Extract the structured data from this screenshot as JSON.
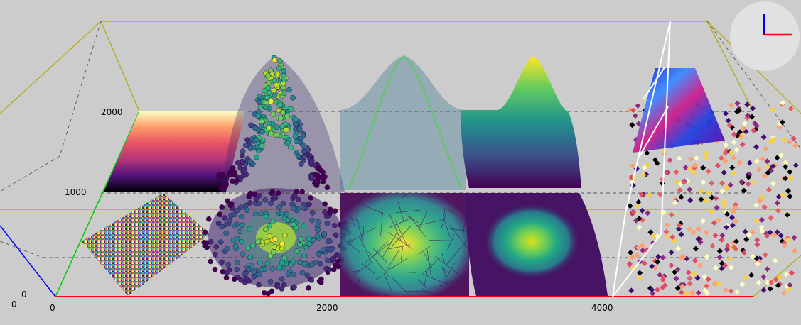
{
  "viewer": {
    "background": "#cccccc",
    "box_color": "#b5ad1f",
    "grid_color": "#555555",
    "axis_colors": {
      "x": "#ff0000",
      "y": "#00cc00",
      "z": "#0000ff"
    },
    "gizmo": {
      "background": "#e1e1e1",
      "x_color": "#ff0000",
      "y_color": "#0000ff"
    }
  },
  "axes": {
    "x_ticks": [
      "0",
      "2000",
      "4000"
    ],
    "y_ticks": [
      "1000",
      "2000"
    ],
    "z_ticks": [
      "0"
    ],
    "origin_label": "0"
  },
  "objects": [
    {
      "name": "random-noise-image",
      "icon": "noise-texture"
    },
    {
      "name": "magma-gradient-image",
      "colormap": "magma"
    },
    {
      "name": "gaussian-scatter-points",
      "colormap": "viridis"
    },
    {
      "name": "gaussian-wireframe-mesh",
      "colormap": "viridis"
    },
    {
      "name": "gaussian-surface",
      "colormap": "viridis"
    },
    {
      "name": "diamond-point-cloud",
      "colormap": "magma"
    }
  ]
}
